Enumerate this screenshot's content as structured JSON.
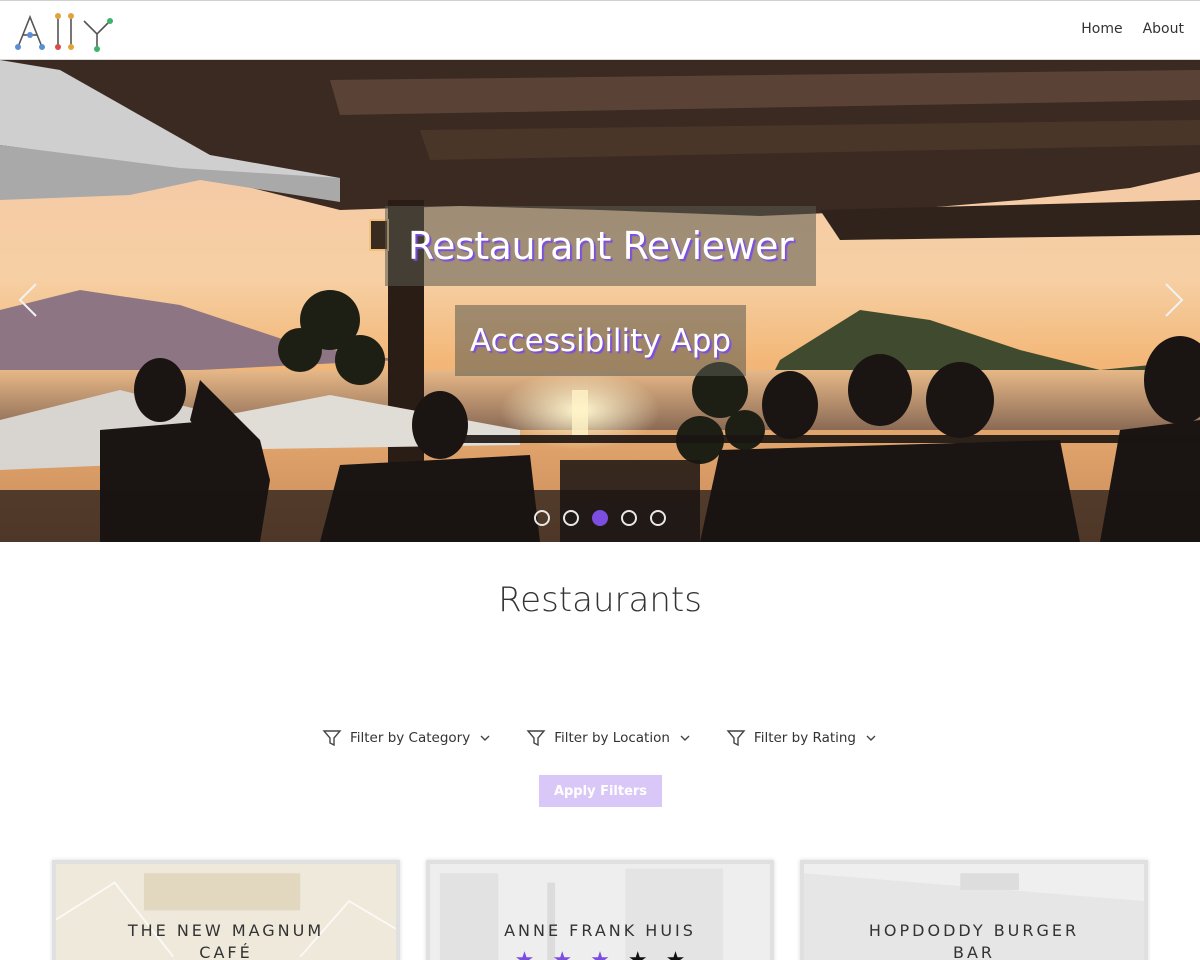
{
  "header": {
    "logo_text": "A11Y",
    "nav": [
      {
        "label": "Home"
      },
      {
        "label": "About"
      }
    ]
  },
  "hero": {
    "title": "Restaurant Reviewer",
    "subtitle": "Accessibility App",
    "slides_count": 5,
    "active_slide": 3
  },
  "main": {
    "title": "Restaurants",
    "filters": [
      {
        "label": "Filter by Category",
        "icon": "filter-icon"
      },
      {
        "label": "Filter by Location",
        "icon": "filter-icon"
      },
      {
        "label": "Filter by Rating",
        "icon": "filter-icon"
      }
    ],
    "apply_label": "Apply Filters",
    "restaurants": [
      {
        "name": "THE NEW MAGNUM CAFÉ",
        "line1": "THE NEW MAGNUM",
        "line2": "CAFÉ"
      },
      {
        "name": "ANNE FRANK HUIS",
        "line1": "ANNE FRANK HUIS",
        "line2": "",
        "rating": 3,
        "max_rating": 5
      },
      {
        "name": "HOPDODDY BURGER BAR",
        "line1": "HOPDODDY BURGER",
        "line2": "BAR"
      }
    ]
  },
  "colors": {
    "accent": "#7b4ee0",
    "apply_button": "#d9c8f7"
  }
}
